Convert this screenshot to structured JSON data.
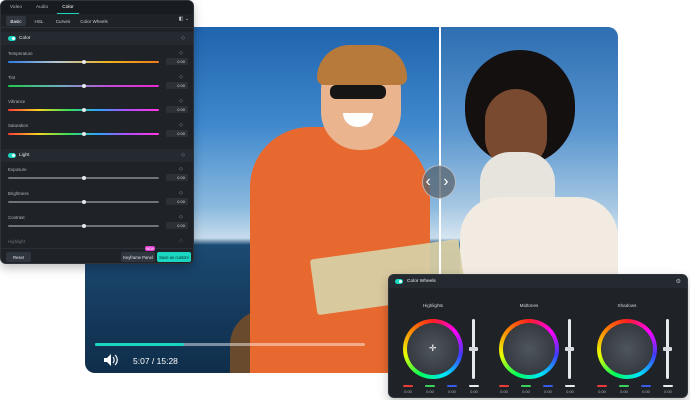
{
  "video": {
    "timecode": "5:07 / 15:28",
    "progress": 0.33,
    "compare_handle_glyph": "‹ ›"
  },
  "left_panel": {
    "top_tabs": [
      "Video",
      "Audio",
      "Color"
    ],
    "active_top_tab": "Color",
    "sub_tabs": [
      "Basic",
      "HSL",
      "Curves",
      "Color Wheels"
    ],
    "active_sub_tab": "Basic",
    "sections": [
      {
        "title": "Color",
        "sliders": [
          {
            "label": "Temperature",
            "value": "0.00",
            "level": 0.5,
            "gradient": "linear-gradient(90deg,#2a7be6,#b9c8cf,#f0b21a,#f07d1a)"
          },
          {
            "label": "Tint",
            "value": "0.00",
            "level": 0.5,
            "gradient": "linear-gradient(90deg,#21c94d,#6db0c0,#c04bd8,#e62ad1)"
          },
          {
            "label": "Vibrance",
            "value": "0.00",
            "level": 0.5,
            "gradient": "linear-gradient(90deg,#ff3a3a,#f7d420,#39e05a,#2ea2ff,#b94aff,#ff3ae0)"
          },
          {
            "label": "Saturation",
            "value": "0.00",
            "level": 0.5,
            "gradient": "linear-gradient(90deg,#ff3a3a,#f7d420,#39e05a,#2ea2ff,#b94aff,#ff3ae0)"
          }
        ]
      },
      {
        "title": "Light",
        "sliders": [
          {
            "label": "Exposure",
            "value": "0.00",
            "level": 0.5
          },
          {
            "label": "Brightness",
            "value": "0.00",
            "level": 0.5
          },
          {
            "label": "Contrast",
            "value": "0.00",
            "level": 0.5
          }
        ]
      }
    ],
    "partial_label": "Highlight",
    "footer": {
      "reset": "Reset",
      "keyframe": "Keyframe Panel",
      "new_badge": "NEW",
      "save": "Save as custom"
    }
  },
  "wheels_panel": {
    "title": "Color Wheels",
    "wheels": [
      {
        "label": "Highlights",
        "values": [
          "0.00",
          "0.00",
          "0.00",
          "0.00"
        ]
      },
      {
        "label": "Midtones",
        "values": [
          "0.00",
          "0.00",
          "0.00",
          "0.00"
        ]
      },
      {
        "label": "Shadows",
        "values": [
          "0.00",
          "0.00",
          "0.00",
          "0.00"
        ]
      }
    ]
  },
  "colors": {
    "accent": "#19d7c1",
    "panel_bg": "#1f2328",
    "hoodie": "#e8692f"
  },
  "icons": [
    "toggle-icon",
    "reset-icon",
    "volume-icon",
    "compare-handle-icon",
    "settings-icon",
    "crosshair-icon"
  ]
}
